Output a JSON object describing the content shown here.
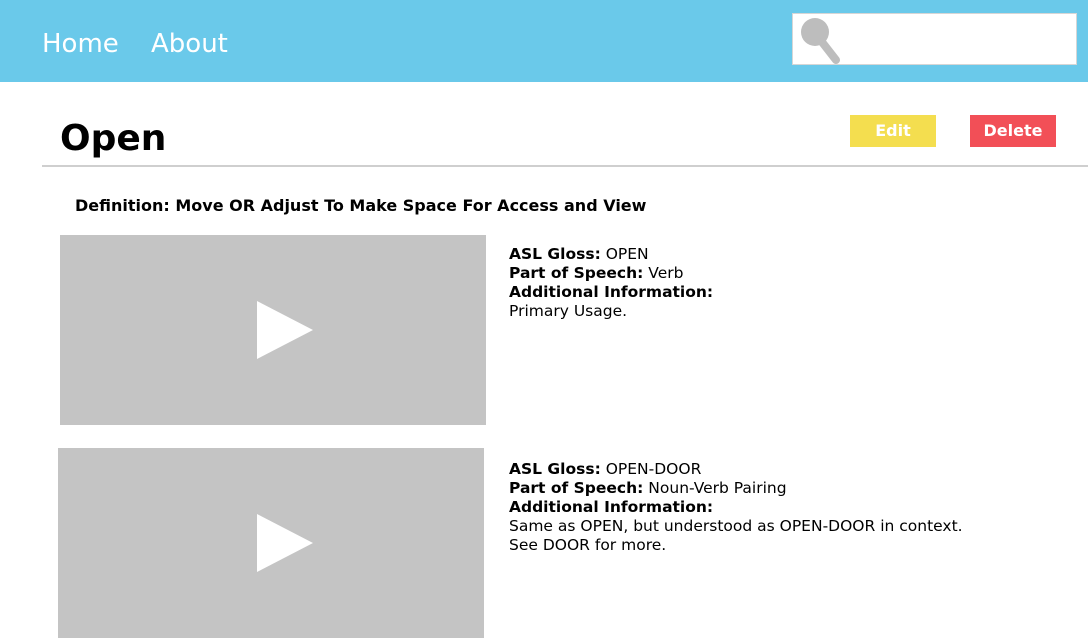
{
  "nav": {
    "home_label": "Home",
    "about_label": "About",
    "search": {
      "value": "",
      "placeholder": "",
      "icon": "magnifier-icon"
    }
  },
  "page": {
    "title": "Open",
    "edit_label": "Edit",
    "delete_label": "Delete",
    "definition": "Definition: Move OR Adjust To Make Space For Access and View"
  },
  "labels": {
    "asl_gloss": "ASL Gloss:",
    "part_of_speech": "Part of Speech:",
    "additional_information": "Additional Information:"
  },
  "entries": [
    {
      "asl_gloss": "OPEN",
      "part_of_speech": "Verb",
      "additional_information": [
        "Primary Usage."
      ]
    },
    {
      "asl_gloss": "OPEN-DOOR",
      "part_of_speech": "Noun-Verb Pairing",
      "additional_information": [
        "Same as OPEN, but understood as OPEN-DOOR in context.",
        "See DOOR for more."
      ]
    }
  ],
  "colors": {
    "navbar": "#6ac9ea",
    "edit_button": "#f4de4f",
    "delete_button": "#f24f57",
    "video_placeholder": "#c4c4c4"
  }
}
